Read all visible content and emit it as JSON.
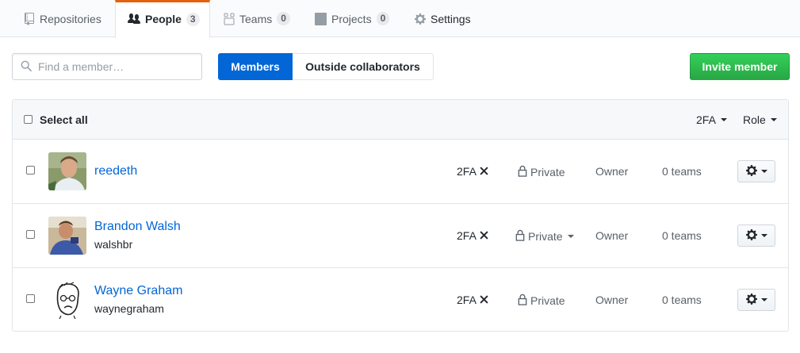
{
  "tabs": [
    {
      "label": "Repositories",
      "icon": "repo-icon",
      "count": null,
      "selected": false
    },
    {
      "label": "People",
      "icon": "people-icon",
      "count": "3",
      "selected": true
    },
    {
      "label": "Teams",
      "icon": "teams-icon",
      "count": "0",
      "selected": false
    },
    {
      "label": "Projects",
      "icon": "project-icon",
      "count": "0",
      "selected": false
    },
    {
      "label": "Settings",
      "icon": "gear-icon",
      "count": null,
      "selected": false
    }
  ],
  "toolbar": {
    "search_placeholder": "Find a member…",
    "members_label": "Members",
    "outside_label": "Outside collaborators",
    "invite_label": "Invite member"
  },
  "table_header": {
    "select_all": "Select all",
    "twofa_filter": "2FA",
    "role_filter": "Role"
  },
  "members": [
    {
      "name": "reedeth",
      "login": "",
      "twofa": "2FA",
      "visibility": "Private",
      "visibility_has_menu": false,
      "role": "Owner",
      "teams": "0 teams"
    },
    {
      "name": "Brandon Walsh",
      "login": "walshbr",
      "twofa": "2FA",
      "visibility": "Private",
      "visibility_has_menu": true,
      "role": "Owner",
      "teams": "0 teams"
    },
    {
      "name": "Wayne Graham",
      "login": "waynegraham",
      "twofa": "2FA",
      "visibility": "Private",
      "visibility_has_menu": false,
      "role": "Owner",
      "teams": "0 teams"
    }
  ],
  "colors": {
    "accent_tab": "#e36209",
    "link_blue": "#0366d6",
    "invite_green": "#28a745"
  }
}
